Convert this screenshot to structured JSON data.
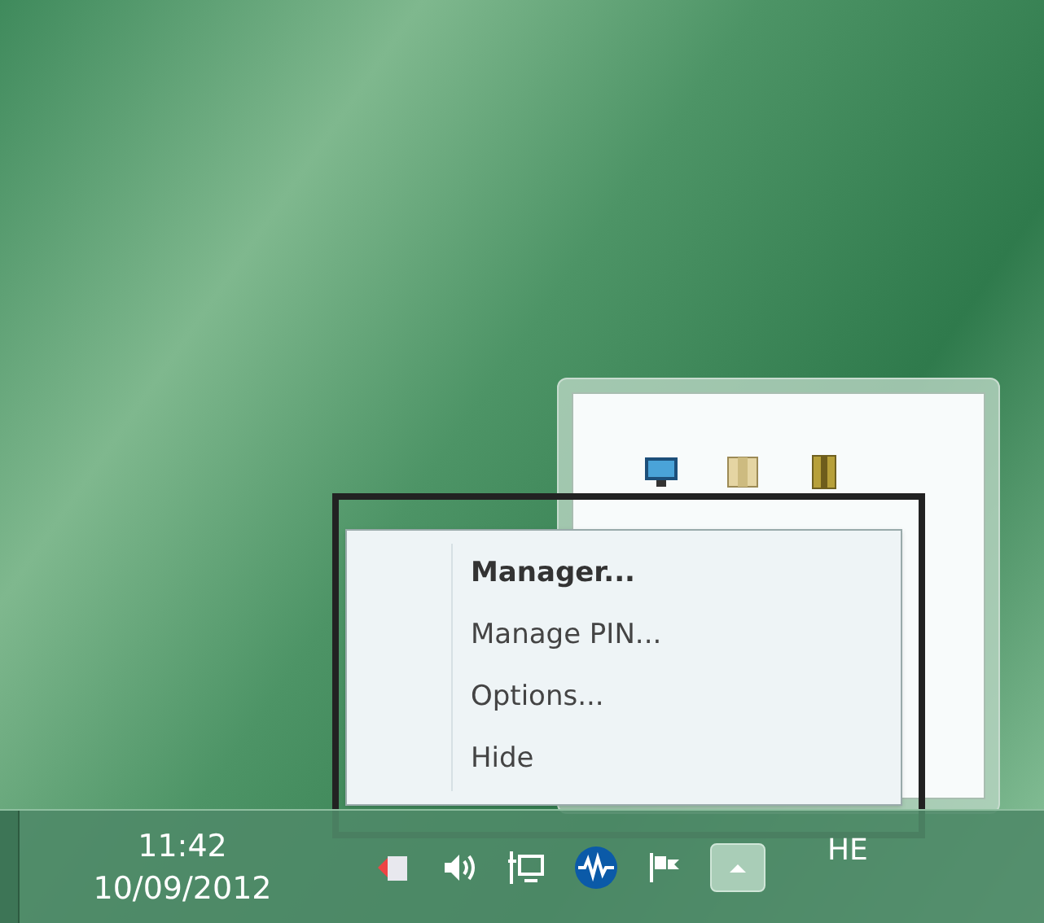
{
  "context_menu": {
    "items": [
      {
        "label": "Manager...",
        "default": true
      },
      {
        "label": "Manage PIN...",
        "default": false
      },
      {
        "label": "Options...",
        "default": false
      },
      {
        "label": "Hide",
        "default": false
      }
    ]
  },
  "taskbar": {
    "clock": {
      "time": "11:42",
      "date": "10/09/2012"
    },
    "language": "HE"
  }
}
